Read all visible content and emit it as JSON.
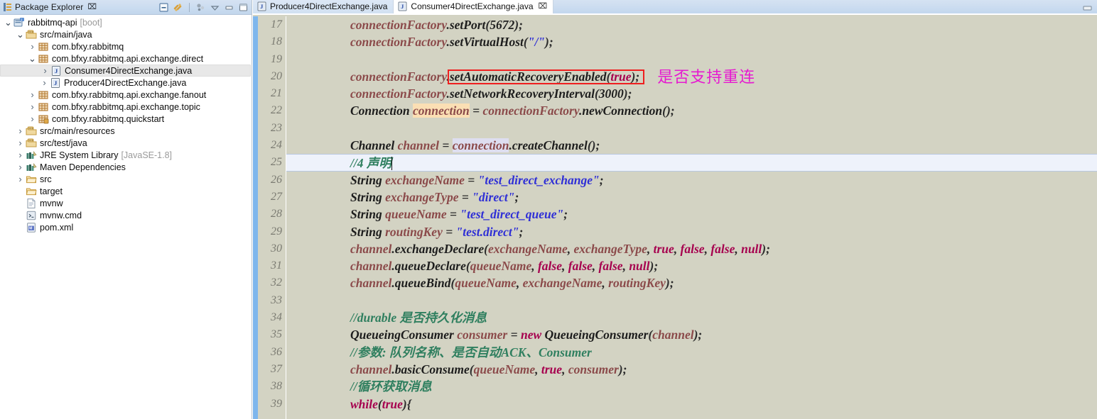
{
  "explorer": {
    "title": "Package Explorer",
    "close_glyph": "⌧",
    "tools": [
      {
        "name": "collapse-all-icon"
      },
      {
        "name": "link-with-editor-icon"
      },
      {
        "name": "view-menu-icon"
      },
      {
        "name": "minimize-icon"
      },
      {
        "name": "maximize-icon"
      }
    ],
    "tree": [
      {
        "indent": 0,
        "twisty": "⌄",
        "icon": "project-icon",
        "label": "rabbitmq-api",
        "suffix": "[boot]",
        "selected": false
      },
      {
        "indent": 1,
        "twisty": "⌄",
        "icon": "source-folder-icon",
        "label": "src/main/java",
        "suffix": "",
        "selected": false
      },
      {
        "indent": 2,
        "twisty": "›",
        "icon": "package-icon",
        "label": "com.bfxy.rabbitmq",
        "suffix": "",
        "selected": false
      },
      {
        "indent": 2,
        "twisty": "⌄",
        "icon": "package-icon",
        "label": "com.bfxy.rabbitmq.api.exchange.direct",
        "suffix": "",
        "selected": false
      },
      {
        "indent": 3,
        "twisty": "›",
        "icon": "java-file-icon",
        "label": "Consumer4DirectExchange.java",
        "suffix": "",
        "selected": true
      },
      {
        "indent": 3,
        "twisty": "›",
        "icon": "java-file-icon",
        "label": "Producer4DirectExchange.java",
        "suffix": "",
        "selected": false
      },
      {
        "indent": 2,
        "twisty": "›",
        "icon": "package-icon",
        "label": "com.bfxy.rabbitmq.api.exchange.fanout",
        "suffix": "",
        "selected": false
      },
      {
        "indent": 2,
        "twisty": "›",
        "icon": "package-icon",
        "label": "com.bfxy.rabbitmq.api.exchange.topic",
        "suffix": "",
        "selected": false
      },
      {
        "indent": 2,
        "twisty": "›",
        "icon": "package-alt-icon",
        "label": "com.bfxy.rabbitmq.quickstart",
        "suffix": "",
        "selected": false
      },
      {
        "indent": 1,
        "twisty": "›",
        "icon": "source-folder-icon",
        "label": "src/main/resources",
        "suffix": "",
        "selected": false
      },
      {
        "indent": 1,
        "twisty": "›",
        "icon": "source-folder-icon",
        "label": "src/test/java",
        "suffix": "",
        "selected": false
      },
      {
        "indent": 1,
        "twisty": "›",
        "icon": "library-icon",
        "label": "JRE System Library",
        "suffix": "[JavaSE-1.8]",
        "selected": false
      },
      {
        "indent": 1,
        "twisty": "›",
        "icon": "library-icon",
        "label": "Maven Dependencies",
        "suffix": "",
        "selected": false
      },
      {
        "indent": 1,
        "twisty": "›",
        "icon": "folder-icon",
        "label": "src",
        "suffix": "",
        "selected": false
      },
      {
        "indent": 1,
        "twisty": "",
        "icon": "folder-icon",
        "label": "target",
        "suffix": "",
        "selected": false
      },
      {
        "indent": 1,
        "twisty": "",
        "icon": "file-icon",
        "label": "mvnw",
        "suffix": "",
        "selected": false
      },
      {
        "indent": 1,
        "twisty": "",
        "icon": "cmd-file-icon",
        "label": "mvnw.cmd",
        "suffix": "",
        "selected": false
      },
      {
        "indent": 1,
        "twisty": "",
        "icon": "xml-file-icon",
        "label": "pom.xml",
        "suffix": "",
        "selected": false
      }
    ]
  },
  "editor": {
    "tabs": [
      {
        "label": "Producer4DirectExchange.java",
        "active": false,
        "closable": false
      },
      {
        "label": "Consumer4DirectExchange.java",
        "active": true,
        "closable": true,
        "close_glyph": "⌧"
      }
    ],
    "minimize_icon": "minimize-icon",
    "first_line_number": 17,
    "current_line_number": 25,
    "line_numbers": [
      17,
      18,
      19,
      20,
      21,
      22,
      23,
      24,
      25,
      26,
      27,
      28,
      29,
      30,
      31,
      32,
      33,
      34,
      35,
      36,
      37,
      38,
      39
    ],
    "lines": [
      {
        "n": 17,
        "text": "connectionFactory.setPort(5672);"
      },
      {
        "n": 18,
        "text": "connectionFactory.setVirtualHost(\"/\");"
      },
      {
        "n": 19,
        "text": ""
      },
      {
        "n": 20,
        "text": "connectionFactory.setAutomaticRecoveryEnabled(true);"
      },
      {
        "n": 21,
        "text": "connectionFactory.setNetworkRecoveryInterval(3000);"
      },
      {
        "n": 22,
        "text": "Connection connection = connectionFactory.newConnection();"
      },
      {
        "n": 23,
        "text": ""
      },
      {
        "n": 24,
        "text": "Channel channel = connection.createChannel();"
      },
      {
        "n": 25,
        "text": "//4 声明"
      },
      {
        "n": 26,
        "text": "String exchangeName = \"test_direct_exchange\";"
      },
      {
        "n": 27,
        "text": "String exchangeType = \"direct\";"
      },
      {
        "n": 28,
        "text": "String queueName = \"test_direct_queue\";"
      },
      {
        "n": 29,
        "text": "String routingKey = \"test.direct\";"
      },
      {
        "n": 30,
        "text": "channel.exchangeDeclare(exchangeName, exchangeType, true, false, false, null);"
      },
      {
        "n": 31,
        "text": "channel.queueDeclare(queueName, false, false, false, null);"
      },
      {
        "n": 32,
        "text": "channel.queueBind(queueName, exchangeName, routingKey);"
      },
      {
        "n": 33,
        "text": ""
      },
      {
        "n": 34,
        "text": "//durable 是否持久化消息"
      },
      {
        "n": 35,
        "text": "QueueingConsumer consumer = new QueueingConsumer(channel);"
      },
      {
        "n": 36,
        "text": "//参数: 队列名称、是否自动ACK、Consumer"
      },
      {
        "n": 37,
        "text": "channel.basicConsume(queueName, true, consumer);"
      },
      {
        "n": 38,
        "text": "//循环获取消息"
      },
      {
        "n": 39,
        "text": "while(true){"
      }
    ]
  },
  "annotation": {
    "note_text": "是否支持重连",
    "note_color": "#e61ad0",
    "box_color": "#ef1f1f",
    "target_line": 20
  },
  "colors": {
    "editor_background": "#d3d3c3",
    "gutter_text": "#7b7b72",
    "change_bar": "#7eb6ec",
    "current_line": "#eef2fb",
    "string": "#2f2fd6",
    "keyword": "#a6004e",
    "comment": "#2f7f5f",
    "field": "#8b4a4a",
    "write_occurrence": "#fbdfb4",
    "read_occurrence": "#dedef0",
    "tab_active": "#ffffff",
    "titlebar": "#cbdcf0"
  }
}
